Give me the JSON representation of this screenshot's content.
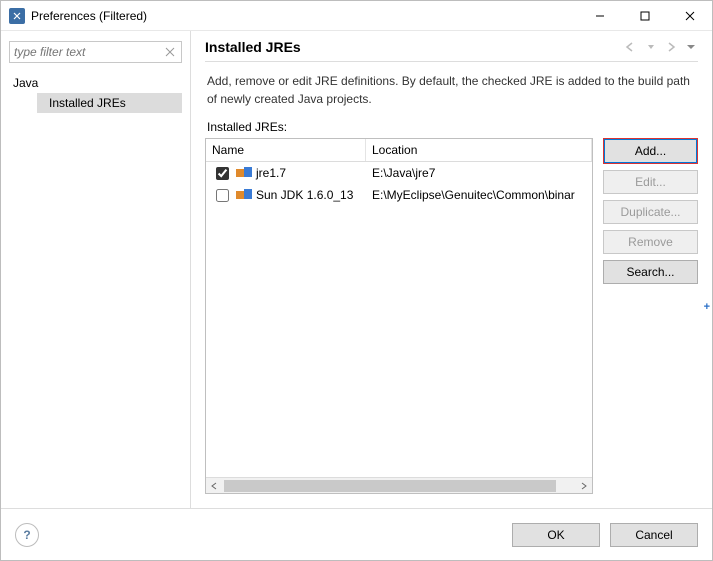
{
  "window": {
    "title": "Preferences (Filtered)"
  },
  "sidebar": {
    "filter_placeholder": "type filter text",
    "items": [
      {
        "label": "Java"
      },
      {
        "label": "Installed JREs"
      }
    ]
  },
  "page": {
    "title": "Installed JREs",
    "description": "Add, remove or edit JRE definitions. By default, the checked JRE is added to the build path of newly created Java projects.",
    "sublabel": "Installed JREs:"
  },
  "table": {
    "columns": {
      "name": "Name",
      "location": "Location"
    },
    "rows": [
      {
        "checked": true,
        "name": "jre1.7",
        "location": "E:\\Java\\jre7"
      },
      {
        "checked": false,
        "name": "Sun JDK 1.6.0_13",
        "location": "E:\\MyEclipse\\Genuitec\\Common\\binar"
      }
    ]
  },
  "actions": {
    "add": "Add...",
    "edit": "Edit...",
    "duplicate": "Duplicate...",
    "remove": "Remove",
    "search": "Search..."
  },
  "footer": {
    "ok": "OK",
    "cancel": "Cancel"
  },
  "icons": {
    "help": "?"
  }
}
